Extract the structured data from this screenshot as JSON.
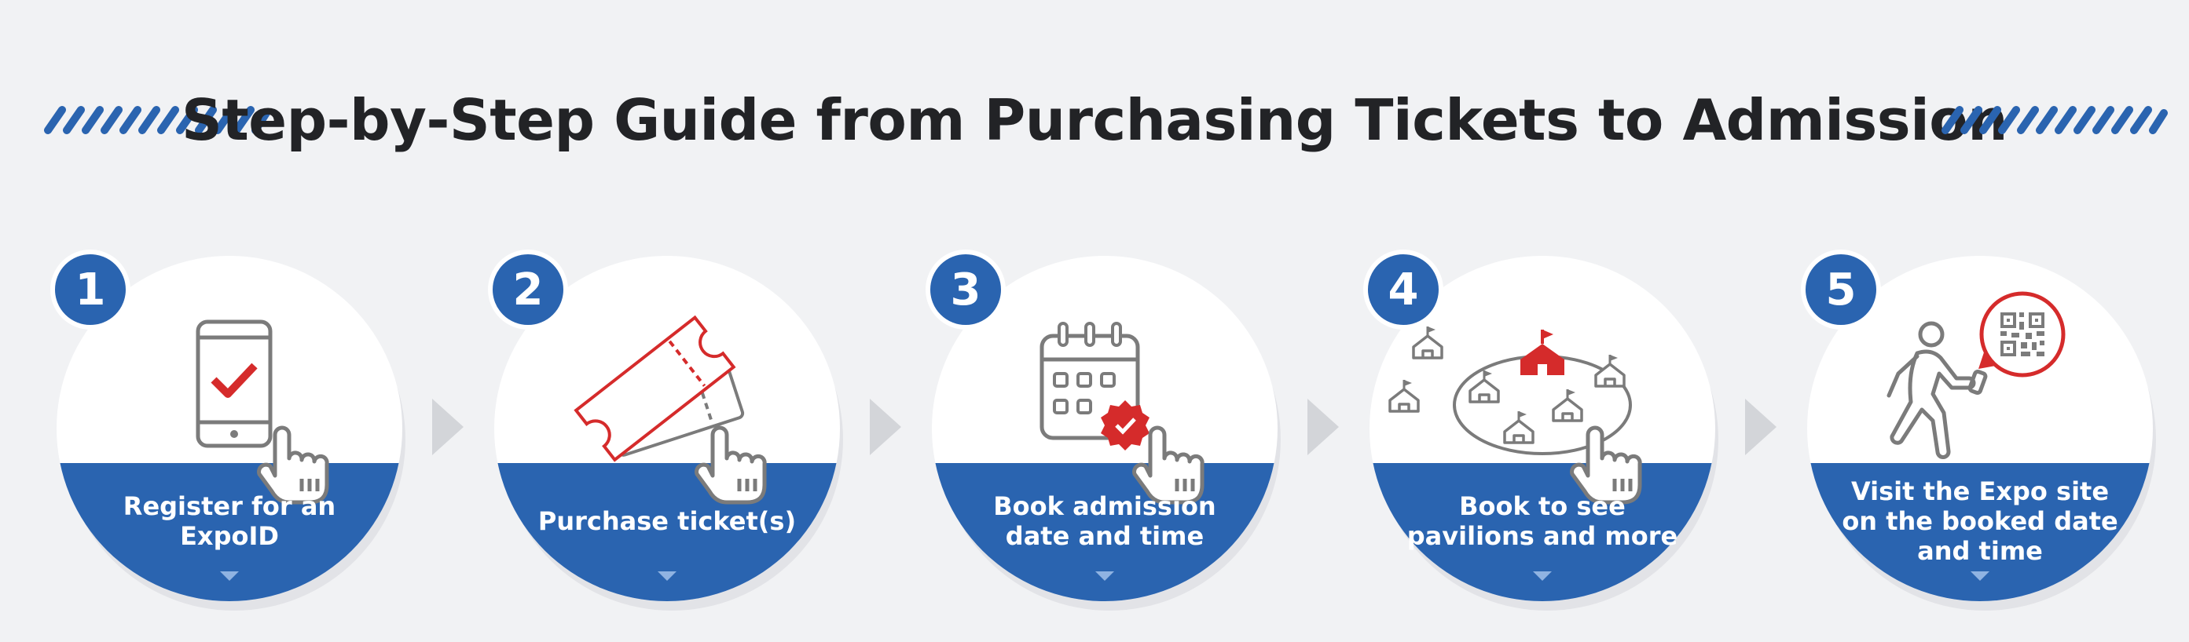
{
  "header": {
    "title": "Step-by-Step Guide from Purchasing Tickets to Admission"
  },
  "colors": {
    "brand_blue": "#2a64b0",
    "accent_red": "#d52b2b",
    "icon_gray": "#7b7b7b",
    "arrow_gray": "#d3d5d9"
  },
  "steps": [
    {
      "number": "1",
      "label": "Register for an\nExpoID",
      "icon": "smartphone-check-icon"
    },
    {
      "number": "2",
      "label": "Purchase ticket(s)",
      "icon": "ticket-icon"
    },
    {
      "number": "3",
      "label": "Book admission\ndate and time",
      "icon": "calendar-check-icon"
    },
    {
      "number": "4",
      "label": "Book to see\npavilions and more",
      "icon": "pavilion-map-icon"
    },
    {
      "number": "5",
      "label": "Visit the Expo site\non the booked date\nand time",
      "icon": "qr-code-walker-icon"
    }
  ]
}
